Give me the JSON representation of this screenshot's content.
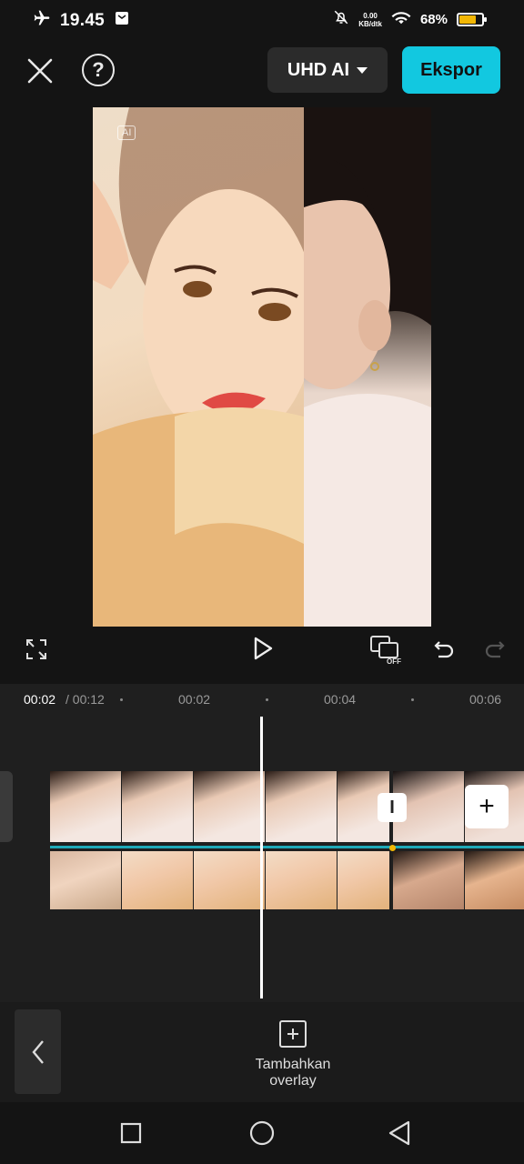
{
  "status_bar": {
    "time": "19.45",
    "net_speed_value": "0.00",
    "net_speed_unit": "KB/dtk",
    "battery_percent": "68%",
    "battery_level": 0.68,
    "battery_color": "#f2b705"
  },
  "top_bar": {
    "close_icon": "close-icon",
    "help_label": "?",
    "quality_label": "UHD AI",
    "export_label": "Ekspor",
    "export_color": "#12c8e0"
  },
  "preview": {
    "watermark_text": "AI"
  },
  "timeline": {
    "current_time": "00:02",
    "total_time": "/ 00:12",
    "ticks": [
      "00:02",
      "00:04",
      "00:06"
    ],
    "transition_label": "I",
    "add_clip_label": "+",
    "accent_color": "#1fa9b8"
  },
  "bottom_panel": {
    "overlay_label_line1": "Tambahkan",
    "overlay_label_line2": "overlay"
  }
}
